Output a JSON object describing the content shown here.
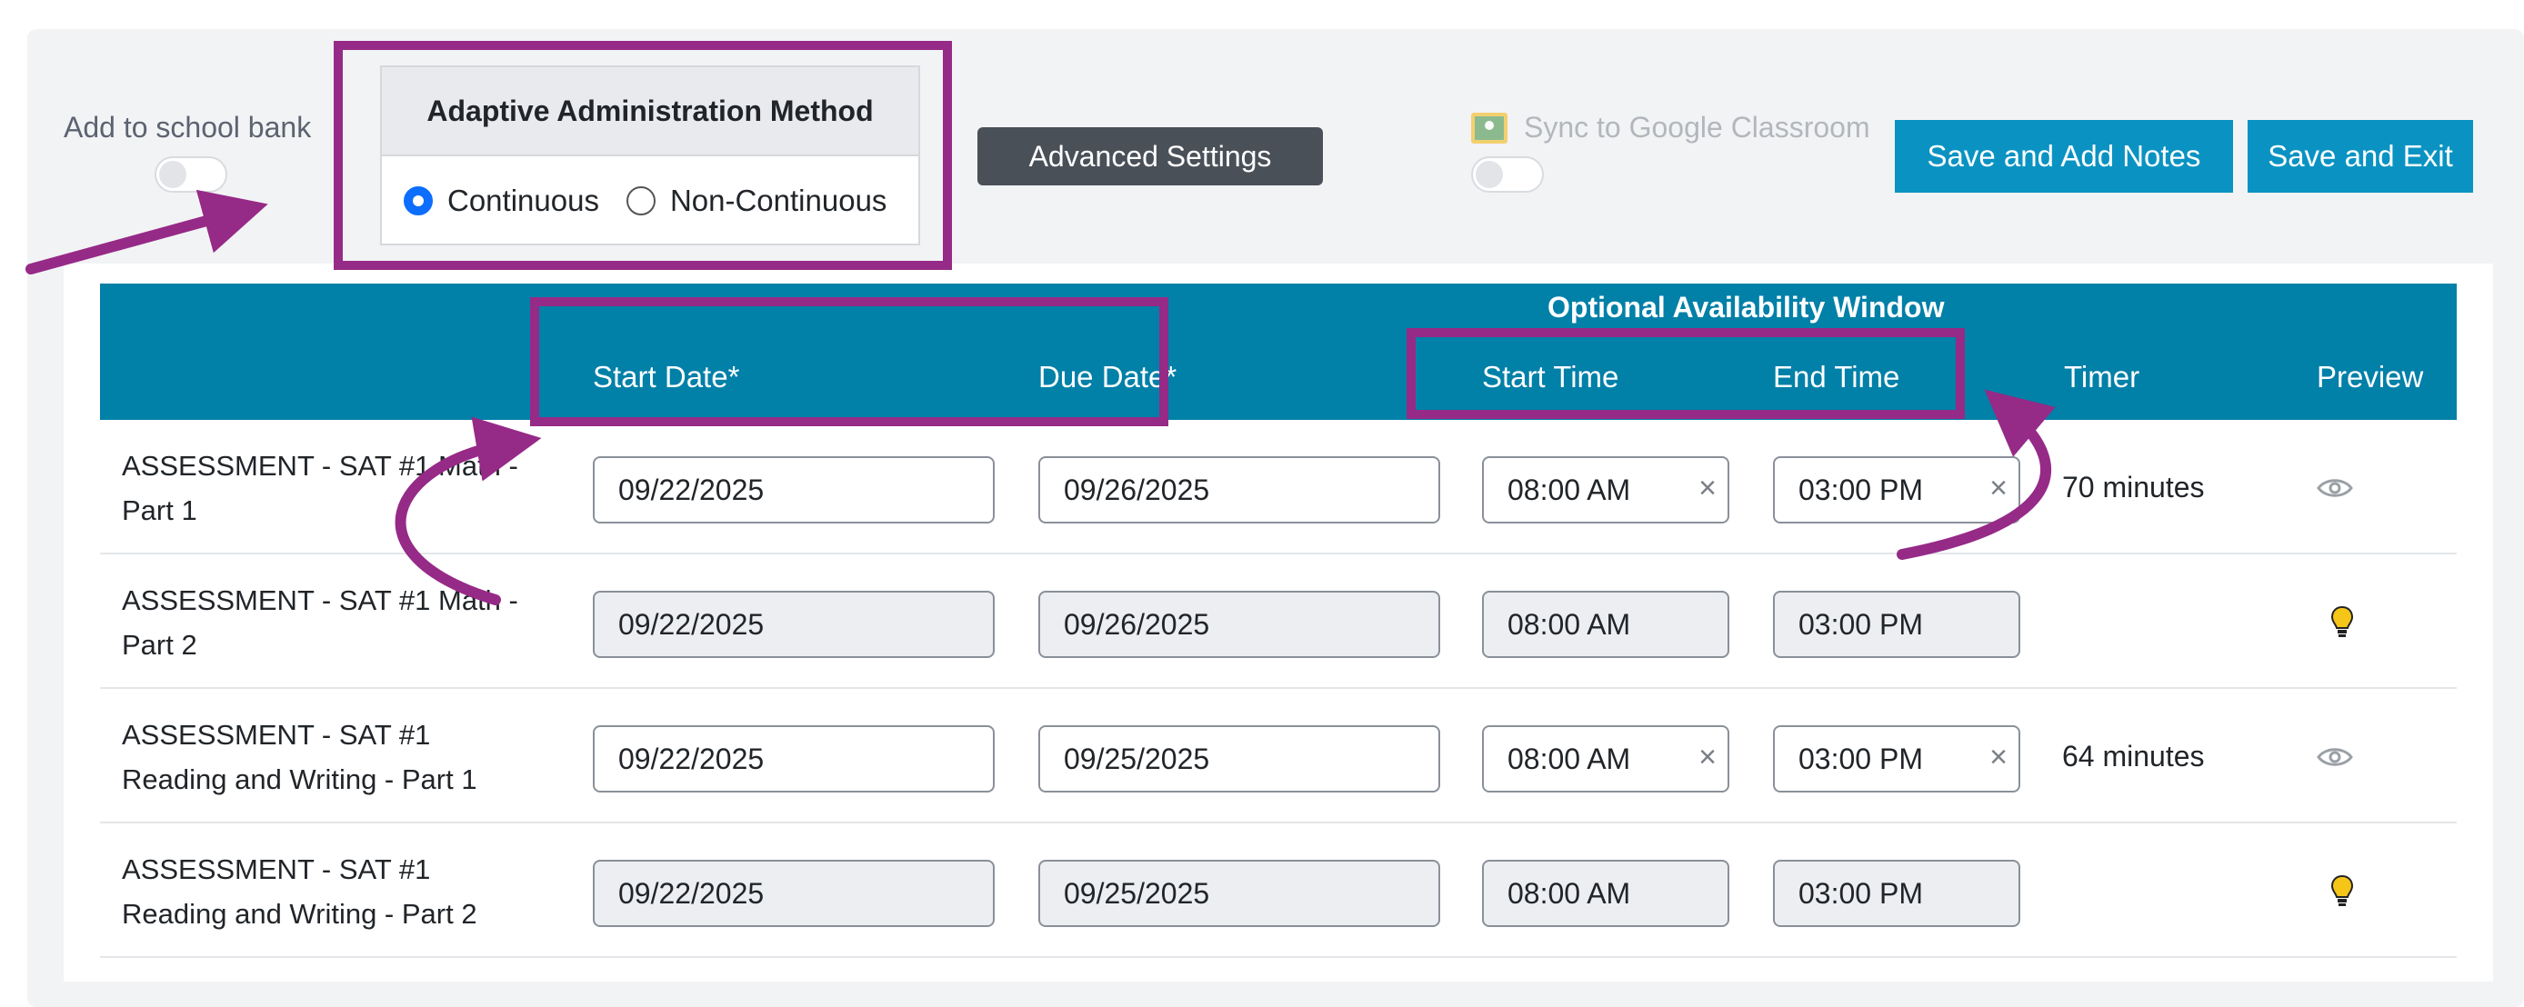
{
  "toolbar": {
    "school_bank_label": "Add to school bank",
    "adaptive_title": "Adaptive Administration Method",
    "option_continuous": "Continuous",
    "option_non_continuous": "Non-Continuous",
    "selected_option": "Continuous",
    "advanced_settings_label": "Advanced Settings",
    "sync_label": "Sync to Google Classroom",
    "save_notes_label": "Save and Add Notes",
    "save_exit_label": "Save and Exit"
  },
  "table": {
    "window_caption": "Optional Availability Window",
    "headers": {
      "start_date": "Start Date*",
      "due_date": "Due Date*",
      "start_time": "Start Time",
      "end_time": "End Time",
      "timer": "Timer",
      "preview": "Preview"
    },
    "rows": [
      {
        "name_line1": "ASSESSMENT - SAT #1 Math -",
        "name_line2": "Part 1",
        "start_date": "09/22/2025",
        "due_date": "09/26/2025",
        "start_time": "08:00 AM",
        "end_time": "03:00 PM",
        "timer": "70 minutes",
        "preview_icon": "eye-icon",
        "editable": true
      },
      {
        "name_line1": "ASSESSMENT - SAT #1 Math -",
        "name_line2": "Part 2",
        "start_date": "09/22/2025",
        "due_date": "09/26/2025",
        "start_time": "08:00 AM",
        "end_time": "03:00 PM",
        "timer": "",
        "preview_icon": "lightbulb-icon",
        "editable": false
      },
      {
        "name_line1": "ASSESSMENT - SAT #1",
        "name_line2": "Reading and Writing - Part 1",
        "start_date": "09/22/2025",
        "due_date": "09/25/2025",
        "start_time": "08:00 AM",
        "end_time": "03:00 PM",
        "timer": "64 minutes",
        "preview_icon": "eye-icon",
        "editable": true
      },
      {
        "name_line1": "ASSESSMENT - SAT #1",
        "name_line2": "Reading and Writing - Part 2",
        "start_date": "09/22/2025",
        "due_date": "09/25/2025",
        "start_time": "08:00 AM",
        "end_time": "03:00 PM",
        "timer": "",
        "preview_icon": "lightbulb-icon",
        "editable": false
      }
    ]
  },
  "colors": {
    "header_bg": "#0180a8",
    "button_teal": "#0a93c2",
    "button_dark": "#4a5058",
    "annotation_purple": "#962a87",
    "bulb_yellow": "#f5c518"
  }
}
